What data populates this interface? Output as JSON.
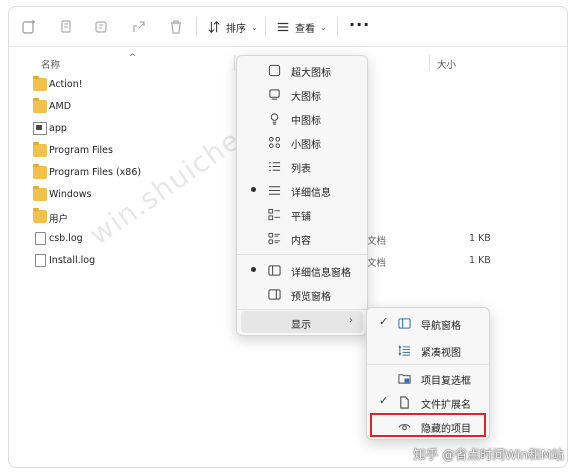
{
  "toolbar": {
    "sort_label": "排序",
    "view_label": "查看",
    "more_label": "···"
  },
  "header": {
    "name_col": "名称",
    "size_col": "大小"
  },
  "files": [
    {
      "name": "Action!",
      "kind": "folder",
      "type": "",
      "size": ""
    },
    {
      "name": "AMD",
      "kind": "folder",
      "type": "",
      "size": ""
    },
    {
      "name": "app",
      "kind": "app",
      "type": "",
      "size": ""
    },
    {
      "name": "Program Files",
      "kind": "folder",
      "type": "",
      "size": ""
    },
    {
      "name": "Program Files (x86)",
      "kind": "folder",
      "type": "",
      "size": ""
    },
    {
      "name": "Windows",
      "kind": "folder",
      "type": "",
      "size": ""
    },
    {
      "name": "用户",
      "kind": "folder",
      "type": "",
      "size": ""
    },
    {
      "name": "csb.log",
      "kind": "file",
      "type": "文档",
      "size": "1 KB"
    },
    {
      "name": "Install.log",
      "kind": "file",
      "type": "文档",
      "size": "1 KB"
    }
  ],
  "view_menu": {
    "items": [
      {
        "label": "超大图标",
        "icon": "monitor-icon",
        "bullet": false
      },
      {
        "label": "大图标",
        "icon": "monitor-icon",
        "bullet": false
      },
      {
        "label": "中图标",
        "icon": "bulb-icon",
        "bullet": false
      },
      {
        "label": "小图标",
        "icon": "grid-icon",
        "bullet": false
      },
      {
        "label": "列表",
        "icon": "list-icon",
        "bullet": false
      },
      {
        "label": "详细信息",
        "icon": "details-icon",
        "bullet": true
      },
      {
        "label": "平铺",
        "icon": "tiles-icon",
        "bullet": false
      },
      {
        "label": "内容",
        "icon": "content-icon",
        "bullet": false
      },
      {
        "label": "详细信息窗格",
        "icon": "details-pane-icon",
        "bullet": true
      },
      {
        "label": "预览窗格",
        "icon": "preview-pane-icon",
        "bullet": false
      },
      {
        "label": "显示",
        "icon": "",
        "bullet": false,
        "submenu": true
      }
    ]
  },
  "show_menu": {
    "items": [
      {
        "label": "导航窗格",
        "icon": "nav-pane-icon",
        "checked": true
      },
      {
        "label": "紧凑视图",
        "icon": "compact-icon",
        "checked": false
      },
      {
        "label": "项目复选框",
        "icon": "checkbox-icon",
        "checked": false
      },
      {
        "label": "文件扩展名",
        "icon": "file-ext-icon",
        "checked": true
      },
      {
        "label": "隐藏的项目",
        "icon": "eye-icon",
        "checked": false
      }
    ]
  },
  "watermark": "win.shuiche.com",
  "credit": "知乎 @省点时间Win和M站",
  "colors": {
    "folder": "#f2c04d",
    "highlight": "#e02424",
    "menu_bg": "#f7f7f7"
  }
}
